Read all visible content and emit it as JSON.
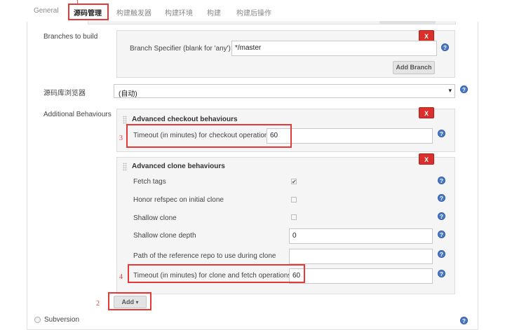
{
  "tabs": [
    {
      "label": "General"
    },
    {
      "label": "源码管理"
    },
    {
      "label": "构建触发器"
    },
    {
      "label": "构建环境"
    },
    {
      "label": "构建"
    },
    {
      "label": "构建后操作"
    }
  ],
  "annotations": [
    "1",
    "2",
    "3",
    "4"
  ],
  "branches": {
    "label": "Branches to build",
    "specifier_label": "Branch Specifier (blank for 'any')",
    "specifier_value": "*/master",
    "add_branch": "Add Branch",
    "delete": "X"
  },
  "browser": {
    "label": "源码库浏览器",
    "value": "(自动)"
  },
  "behaviours": {
    "label": "Additional Behaviours",
    "checkout": {
      "title": "Advanced checkout behaviours",
      "timeout_label": "Timeout (in minutes) for checkout operation",
      "timeout_value": "60",
      "delete": "X"
    },
    "clone": {
      "title": "Advanced clone behaviours",
      "delete": "X",
      "fetch_tags": {
        "label": "Fetch tags",
        "checked": true
      },
      "honor_refspec": {
        "label": "Honor refspec on initial clone",
        "checked": false
      },
      "shallow_clone": {
        "label": "Shallow clone",
        "checked": false
      },
      "shallow_depth": {
        "label": "Shallow clone depth",
        "value": "0"
      },
      "reference_repo": {
        "label": "Path of the reference repo to use during clone",
        "value": ""
      },
      "timeout": {
        "label": "Timeout (in minutes) for clone and fetch operations",
        "value": "60"
      }
    },
    "add_button": "Add"
  },
  "subversion": {
    "label": "Subversion"
  },
  "icons": {
    "help": "?",
    "checkmark": "✔",
    "caret": "▾"
  },
  "colors": {
    "annotation": "#e53935",
    "delete_button": "#d9302c",
    "help_icon": "#4a79c8"
  }
}
